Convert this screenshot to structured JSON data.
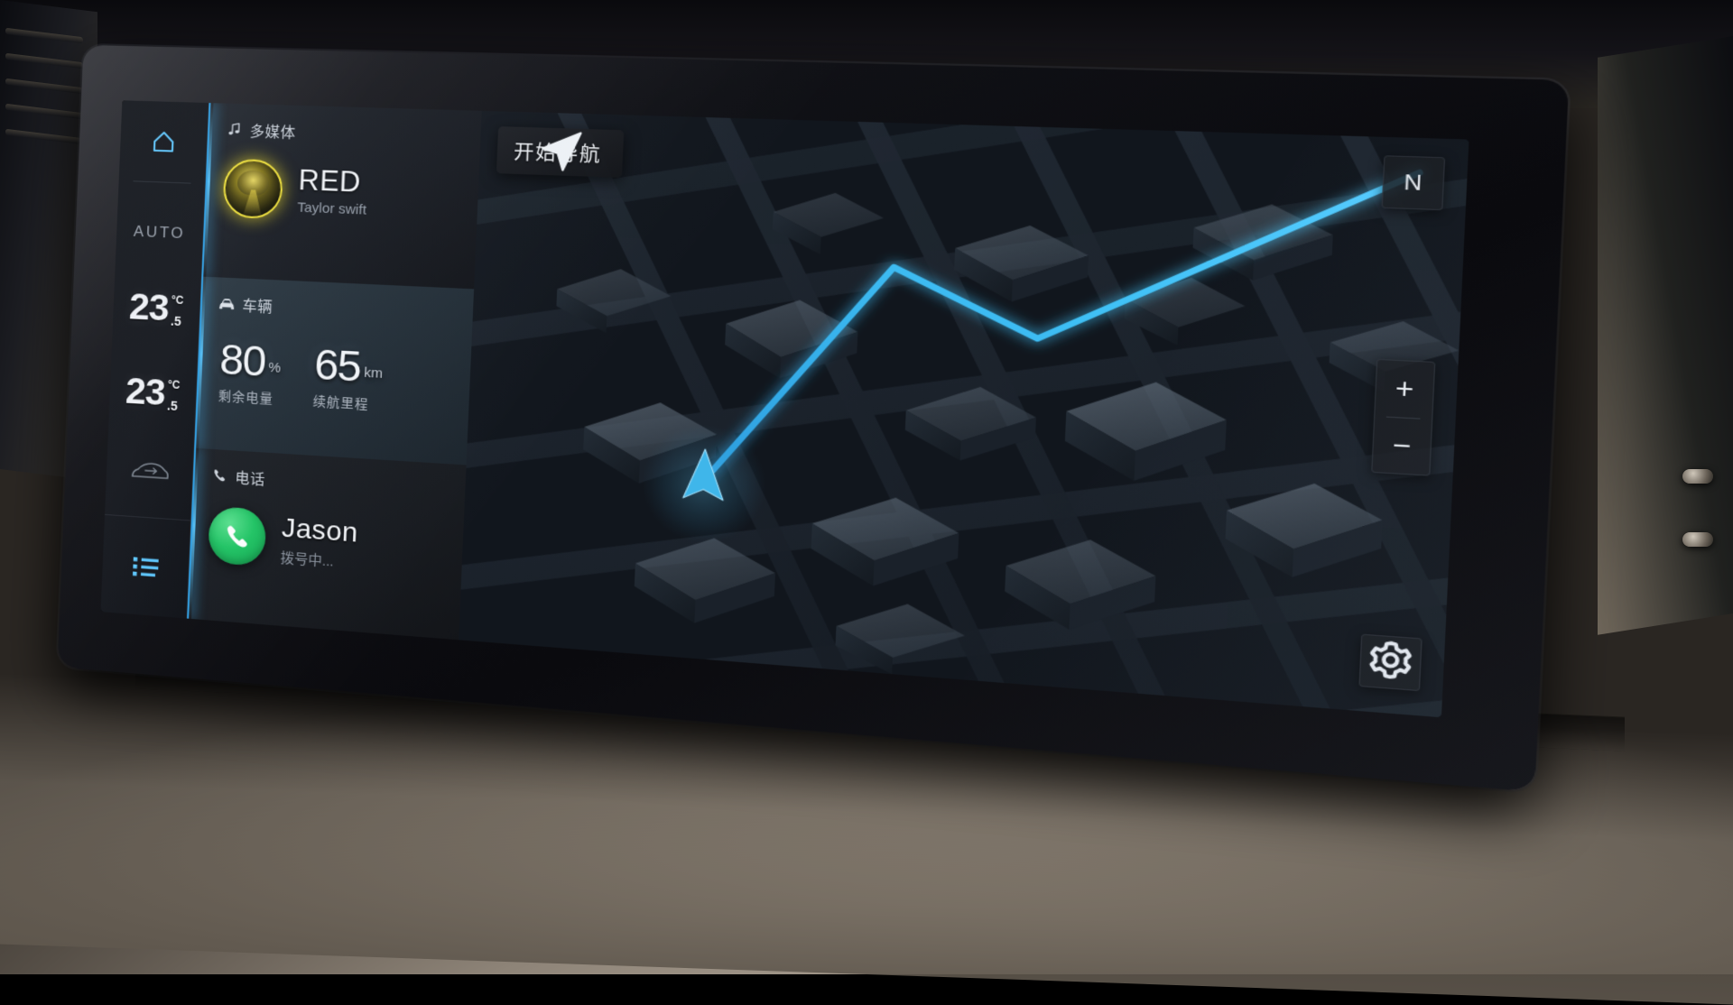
{
  "climate": {
    "home_icon": "home-icon",
    "auto_label": "AUTO",
    "driver": {
      "temp": "23",
      "unit": "°C",
      "decimal": ".5"
    },
    "passenger": {
      "temp": "23",
      "unit": "°C",
      "decimal": ".5"
    },
    "airflow_icon": "car-airflow-icon",
    "menu_icon": "list-menu-icon",
    "accent_color": "#5ec8ff"
  },
  "media_card": {
    "icon": "music-note-icon",
    "title": "多媒体",
    "album_art": "album-art-avatar",
    "track": "RED",
    "artist": "Taylor swift",
    "glow_color": "#f2e23a"
  },
  "vehicle_card": {
    "icon": "car-icon",
    "title": "车辆",
    "stats": [
      {
        "value": "80",
        "unit": "%",
        "label": "剩余电量"
      },
      {
        "value": "65",
        "unit": "km",
        "label": "续航里程"
      }
    ]
  },
  "phone_card": {
    "icon": "phone-icon",
    "title": "电话",
    "call_icon": "phone-handset-icon",
    "contact": "Jason",
    "status": "拨号中...",
    "accent_color": "#21c464"
  },
  "map": {
    "nav_button": {
      "icon": "navigation-arrow-icon",
      "label": "开始导航"
    },
    "compass_label": "N",
    "zoom_in_label": "+",
    "zoom_out_label": "−",
    "settings_icon": "gear-icon",
    "route_color": "#2da7e8",
    "marker_icon": "position-arrow-marker"
  }
}
